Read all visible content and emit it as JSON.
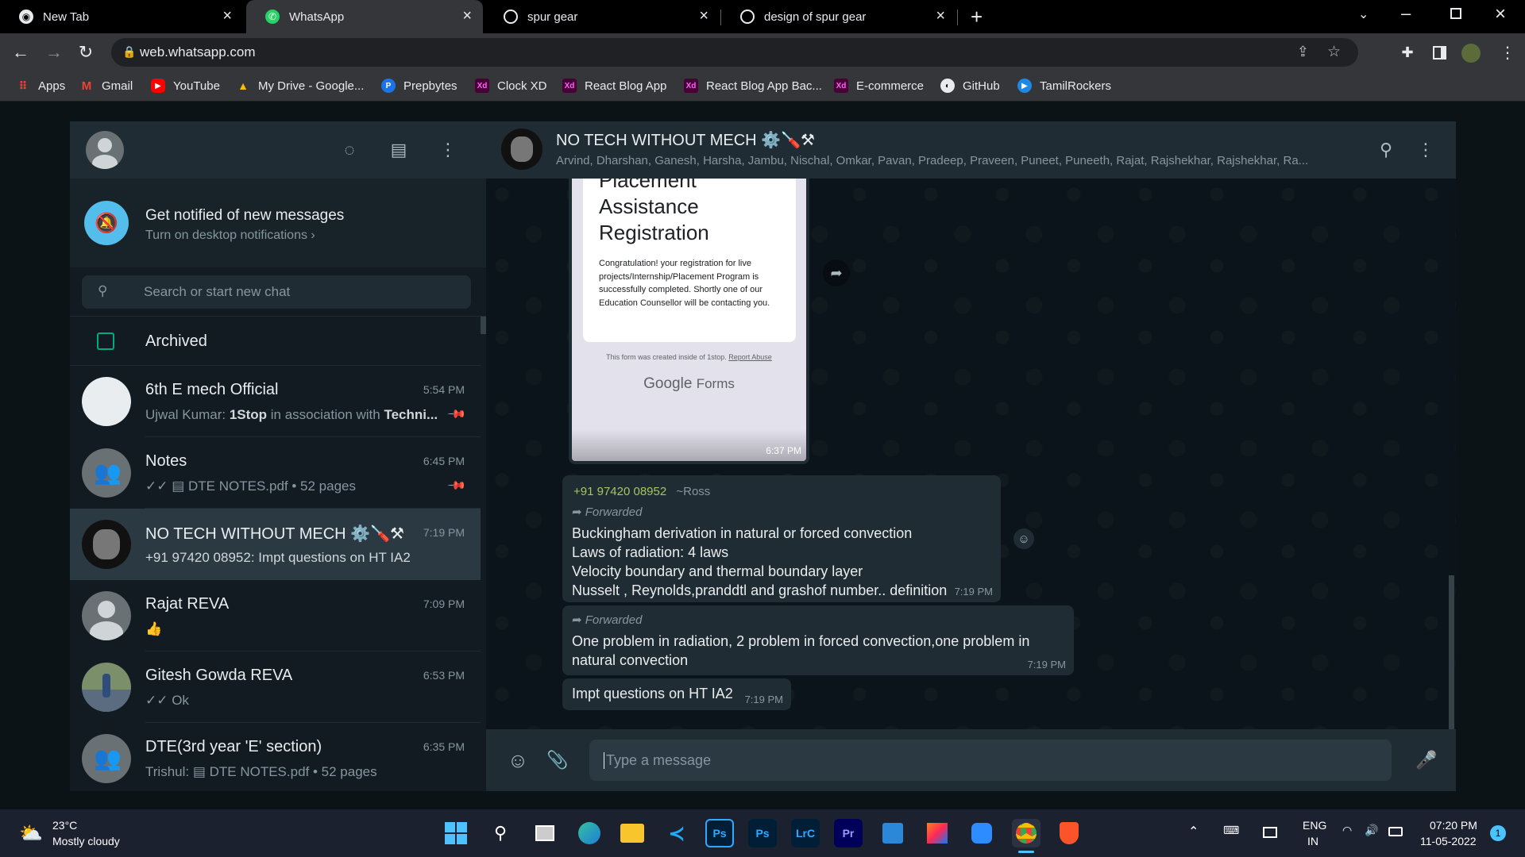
{
  "browser": {
    "tabs": [
      {
        "label": "New Tab"
      },
      {
        "label": "WhatsApp"
      },
      {
        "label": "spur gear"
      },
      {
        "label": "design of spur gear"
      }
    ],
    "url": "web.whatsapp.com",
    "bookmarks": [
      {
        "label": "Apps"
      },
      {
        "label": "Gmail"
      },
      {
        "label": "YouTube"
      },
      {
        "label": "My Drive - Google..."
      },
      {
        "label": "Prepbytes"
      },
      {
        "label": "Clock XD"
      },
      {
        "label": "React Blog App"
      },
      {
        "label": "React Blog App Bac..."
      },
      {
        "label": "E-commerce"
      },
      {
        "label": "GitHub"
      },
      {
        "label": "TamilRockers"
      }
    ],
    "xd_badge": "Xd"
  },
  "sidebar": {
    "notification": {
      "title": "Get notified of new messages",
      "subtitle": "Turn on desktop notifications ›"
    },
    "search_placeholder": "Search or start new chat",
    "archived_label": "Archived",
    "chats": [
      {
        "name": "6th E mech Official",
        "time": "5:54 PM",
        "preview_sender": "Ujwal Kumar: ",
        "preview_bold": "1Stop",
        "preview_rest": " in association with ",
        "preview_bold2": "Techni...",
        "pinned": true
      },
      {
        "name": "Notes",
        "time": "6:45 PM",
        "preview": "✓✓ ▤ DTE NOTES.pdf • 52 pages",
        "pinned": true
      },
      {
        "name": "NO TECH WITHOUT MECH ⚙️🪛⚒",
        "time": "7:19 PM",
        "preview": "+91 97420 08952: Impt questions on HT IA2",
        "selected": true
      },
      {
        "name": "Rajat REVA",
        "time": "7:09 PM",
        "preview": "👍"
      },
      {
        "name": "Gitesh Gowda REVA",
        "time": "6:53 PM",
        "preview": "✓✓ Ok"
      },
      {
        "name": "DTE(3rd year 'E' section)",
        "time": "6:35 PM",
        "preview": "Trishul: ▤ DTE NOTES.pdf • 52 pages"
      }
    ]
  },
  "conversation": {
    "title": "NO TECH WITHOUT MECH ⚙️🪛⚒",
    "members": "Arvind, Dharshan, Ganesh, Harsha, Jambu, Nischal, Omkar, Pavan, Pradeep, Praveen, Puneet, Puneeth, Rajat, Rajshekhar, Rajshekhar, Ra...",
    "form_image": {
      "title_lines": [
        "Placement",
        "Assistance",
        "Registration"
      ],
      "body": "Congratulation! your registration for live projects/Internship/Placement Program is successfully completed.  Shortly one of our Education Counsellor will be contacting you.",
      "footer": "This form was created inside of 1stop.",
      "footer_link": "Report Abuse",
      "brand_google": "Google",
      "brand_forms": "Forms",
      "time": "6:37 PM"
    },
    "messages": [
      {
        "sender": "+91 97420 08952",
        "alias": "~Ross",
        "forwarded": "Forwarded",
        "lines": [
          "Buckingham derivation in natural or forced convection",
          "Laws of radiation: 4 laws",
          "Velocity boundary and thermal boundary layer",
          "Nusselt , Reynolds,pranddtl and grashof number.. definition"
        ],
        "time": "7:19 PM"
      },
      {
        "forwarded": "Forwarded",
        "lines": [
          "One problem in radiation,  2 problem in forced convection,one problem in",
          "natural convection"
        ],
        "time": "7:19 PM"
      },
      {
        "lines": [
          "Impt questions on HT IA2"
        ],
        "time": "7:19 PM"
      }
    ],
    "composer_placeholder": "Type a message"
  },
  "taskbar": {
    "weather_temp": "23°C",
    "weather_desc": "Mostly cloudy",
    "lang_top": "ENG",
    "lang_bottom": "IN",
    "time": "07:20 PM",
    "date": "11-05-2022",
    "notification_count": "1",
    "app_labels": {
      "ps": "Ps",
      "lrc": "LrC",
      "pr": "Pr"
    }
  },
  "colors": {
    "accent": "#00a884",
    "sender": "#a4c660",
    "panel": "#202c33",
    "background": "#111b21"
  }
}
